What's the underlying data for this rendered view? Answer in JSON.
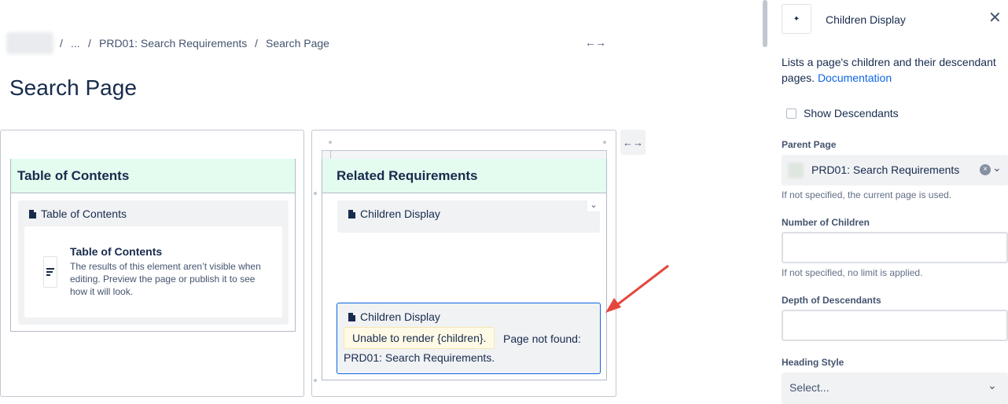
{
  "breadcrumb": {
    "ellipsis": "...",
    "separator": "/",
    "parent": "PRD01: Search Requirements",
    "current": "Search Page"
  },
  "page": {
    "title": "Search Page"
  },
  "width_toggle": "↔",
  "left_column": {
    "table_header": "Table of Contents",
    "macro_title": "Table of Contents",
    "card_title": "Table of Contents",
    "card_text": "The results of this element aren’t visible when editing. Preview the page or publish it to see how it will look."
  },
  "right_column": {
    "table_header": "Related Requirements",
    "macro1_title": "Children Display",
    "macro2_title": "Children Display",
    "error_badge": "Unable to render {children}.",
    "error_text_1": "Page not found:",
    "error_text_2": "PRD01: Search Requirements."
  },
  "panel": {
    "title": "Children Display",
    "description": "Lists a page's children and their descendant pages.",
    "doc_link": "Documentation",
    "show_descendants_label": "Show Descendants",
    "show_descendants_checked": false,
    "parent_page_label": "Parent Page",
    "parent_page_value": "PRD01: Search Requirements",
    "parent_page_help": "If not specified, the current page is used.",
    "num_children_label": "Number of Children",
    "num_children_value": "",
    "num_children_help": "If not specified, no limit is applied.",
    "depth_label": "Depth of Descendants",
    "depth_value": "",
    "heading_style_label": "Heading Style",
    "heading_style_value": "Select..."
  },
  "colors": {
    "table_header_bg": "#e3fcef",
    "selection_border": "#0c66e4",
    "link": "#0c66e4",
    "error_badge_bg": "#fffae6",
    "annotation_arrow": "#e5473f"
  }
}
